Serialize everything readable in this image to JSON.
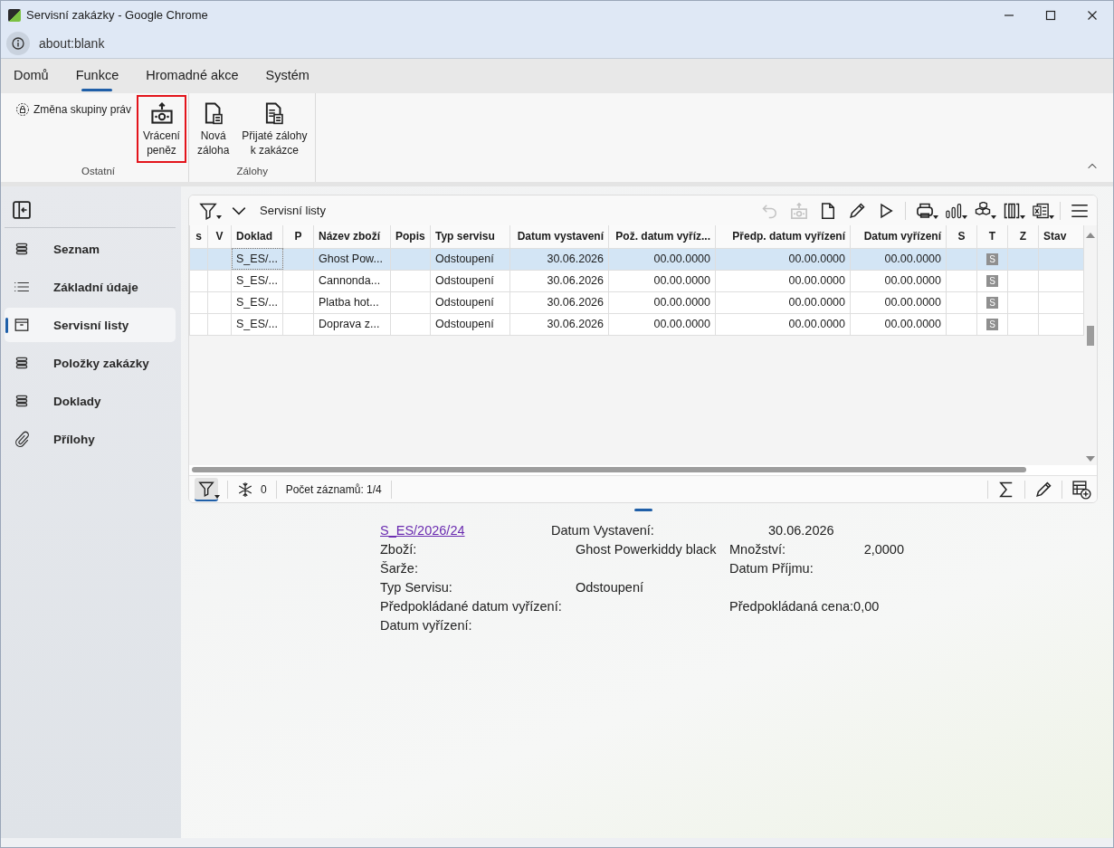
{
  "window": {
    "title": "Servisní zakázky - Google Chrome",
    "url": "about:blank"
  },
  "ribbon": {
    "tabs": [
      {
        "label": "Domů",
        "selected": false
      },
      {
        "label": "Funkce",
        "selected": true
      },
      {
        "label": "Hromadné akce",
        "selected": false
      },
      {
        "label": "Systém",
        "selected": false
      }
    ],
    "groups": [
      {
        "label": "Ostatní",
        "buttons": [
          {
            "kind": "small",
            "label": "Změna skupiny práv",
            "highlighted": false
          },
          {
            "kind": "large",
            "label": "Vrácení\npeněz",
            "highlighted": true
          }
        ]
      },
      {
        "label": "Zálohy",
        "buttons": [
          {
            "kind": "large",
            "label": "Nová\nzáloha",
            "highlighted": false
          },
          {
            "kind": "large",
            "label": "Přijaté zálohy\nk zakázce",
            "highlighted": false
          }
        ]
      }
    ]
  },
  "sidebar": {
    "items": [
      {
        "label": "Seznam",
        "selected": false
      },
      {
        "label": "Základní údaje",
        "selected": false
      },
      {
        "label": "Servisní listy",
        "selected": true
      },
      {
        "label": "Položky zakázky",
        "selected": false
      },
      {
        "label": "Doklady",
        "selected": false
      },
      {
        "label": "Přílohy",
        "selected": false
      }
    ]
  },
  "grid": {
    "title": "Servisní listy",
    "toolbar": [
      {
        "kind": "undo",
        "disabled": true,
        "dropdown": false
      },
      {
        "kind": "money",
        "disabled": true,
        "dropdown": false
      },
      {
        "kind": "new",
        "disabled": false,
        "dropdown": false
      },
      {
        "kind": "edit",
        "disabled": false,
        "dropdown": false
      },
      {
        "kind": "play",
        "disabled": false,
        "dropdown": false
      },
      {
        "kind": "print",
        "disabled": false,
        "dropdown": true
      },
      {
        "kind": "chart",
        "disabled": false,
        "dropdown": true
      },
      {
        "kind": "cubes",
        "disabled": false,
        "dropdown": true
      },
      {
        "kind": "columns",
        "disabled": false,
        "dropdown": true
      },
      {
        "kind": "excel",
        "disabled": false,
        "dropdown": true
      },
      {
        "kind": "menu",
        "disabled": false,
        "dropdown": false
      }
    ],
    "columns": [
      {
        "label": "s"
      },
      {
        "label": "V"
      },
      {
        "label": "Doklad"
      },
      {
        "label": "P"
      },
      {
        "label": "Název zboží"
      },
      {
        "label": "Popis"
      },
      {
        "label": "Typ servisu"
      },
      {
        "label": "Datum vystavení"
      },
      {
        "label": "Pož. datum vyříz..."
      },
      {
        "label": "Předp. datum vyřízení"
      },
      {
        "label": "Datum vyřízení"
      },
      {
        "label": "S"
      },
      {
        "label": "T"
      },
      {
        "label": "Z"
      },
      {
        "label": "Stav"
      }
    ],
    "rows": [
      {
        "selected": true,
        "cells": [
          "",
          "",
          "S_ES/...",
          "",
          "Ghost Pow...",
          "",
          "Odstoupení",
          "30.06.2026",
          "00.00.0000",
          "00.00.0000",
          "00.00.0000",
          "",
          "S",
          "",
          ""
        ]
      },
      {
        "selected": false,
        "cells": [
          "",
          "",
          "S_ES/...",
          "",
          "Cannonda...",
          "",
          "Odstoupení",
          "30.06.2026",
          "00.00.0000",
          "00.00.0000",
          "00.00.0000",
          "",
          "S",
          "",
          ""
        ]
      },
      {
        "selected": false,
        "cells": [
          "",
          "",
          "S_ES/...",
          "",
          "Platba hot...",
          "",
          "Odstoupení",
          "30.06.2026",
          "00.00.0000",
          "00.00.0000",
          "00.00.0000",
          "",
          "S",
          "",
          ""
        ]
      },
      {
        "selected": false,
        "cells": [
          "",
          "",
          "S_ES/...",
          "",
          "Doprava z...",
          "",
          "Odstoupení",
          "30.06.2026",
          "00.00.0000",
          "00.00.0000",
          "00.00.0000",
          "",
          "S",
          "",
          ""
        ]
      }
    ],
    "footer": {
      "filter_active": true,
      "frozen_count": "0",
      "record_count": "Počet záznamů: 1/4"
    }
  },
  "detail": {
    "lines": [
      [
        {
          "kind": "link",
          "text": "S_ES/2026/24"
        },
        {
          "kind": "label",
          "text": "Datum Vystavení:"
        },
        {
          "kind": "value",
          "text": "30.06.2026"
        }
      ],
      [
        {
          "kind": "label",
          "text": "Zboží:"
        },
        {
          "kind": "value",
          "text": "Ghost Powerkiddy black"
        },
        {
          "kind": "label",
          "text": "Množství:"
        },
        {
          "kind": "number",
          "text": "2,0000"
        }
      ],
      [
        {
          "kind": "label",
          "text": "Šarže:"
        },
        {
          "kind": "label",
          "text": "Datum Příjmu:"
        }
      ],
      [
        {
          "kind": "label",
          "text": "Typ Servisu:"
        },
        {
          "kind": "value",
          "text": "Odstoupení"
        }
      ],
      [
        {
          "kind": "label",
          "text": "Předpokládané datum vyřízení:"
        },
        {
          "kind": "label",
          "text": "Předpokládaná cena:"
        },
        {
          "kind": "value",
          "text": "0,00"
        }
      ],
      [
        {
          "kind": "label",
          "text": "Datum vyřízení:"
        }
      ]
    ]
  }
}
